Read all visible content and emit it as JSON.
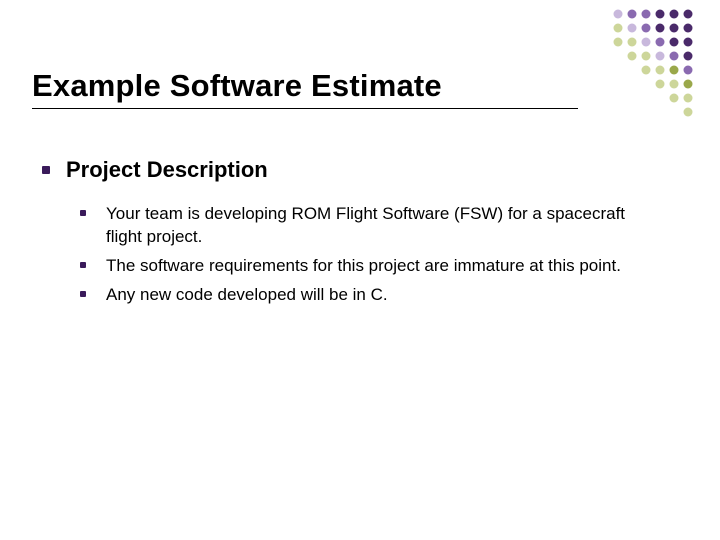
{
  "title": "Example Software Estimate",
  "section": {
    "heading": "Project Description",
    "items": [
      "Your team is developing ROM Flight Software (FSW) for a spacecraft flight project.",
      "The software requirements for this project are immature at this point.",
      "Any new code developed will be in C."
    ]
  },
  "decoration": {
    "dot_colors": {
      "dark_purple": "#4a2a6a",
      "mid_purple": "#8a6ab0",
      "light_purple": "#c8b8dc",
      "olive": "#9aa84a",
      "light_olive": "#cdd69a"
    }
  }
}
